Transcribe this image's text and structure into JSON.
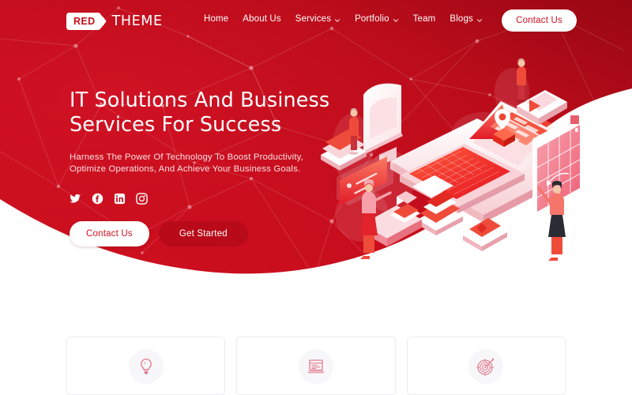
{
  "site": {
    "brand": {
      "mark_text": "RED",
      "name_text": "THEME",
      "logo_icon": "tag-bubble-logo-icon"
    }
  },
  "colors": {
    "brand_red": "#c70d1d",
    "brand_red_dark": "#a50817",
    "brand_red_deep": "#b80a19",
    "hero_text": "#ffffff",
    "hero_subtext": "#fbdfe2",
    "card_icon": "#e0798c",
    "card_circle_bg": "#f7f7f9",
    "page_bg": "#ffffff"
  },
  "nav": {
    "items": [
      {
        "label": "Home",
        "has_dropdown": false,
        "icon": ""
      },
      {
        "label": "About Us",
        "has_dropdown": false,
        "icon": ""
      },
      {
        "label": "Services",
        "has_dropdown": true,
        "icon": "chevron-down-icon"
      },
      {
        "label": "Portfolio",
        "has_dropdown": true,
        "icon": "chevron-down-icon"
      },
      {
        "label": "Team",
        "has_dropdown": false,
        "icon": ""
      },
      {
        "label": "Blogs",
        "has_dropdown": true,
        "icon": "chevron-down-icon"
      }
    ],
    "cta_label": "Contact Us"
  },
  "hero": {
    "title_line_1": "IT Solutions And Business",
    "title_line_2": "Services For Success",
    "subtitle": "Harness The Power Of Technology To Boost Productivity, Optimize Operations, And Achieve Your Business Goals.",
    "socials": [
      {
        "name": "twitter-icon",
        "label": "Twitter"
      },
      {
        "name": "facebook-icon",
        "label": "Facebook"
      },
      {
        "name": "linkedin-icon",
        "label": "LinkedIn"
      },
      {
        "name": "instagram-icon",
        "label": "Instagram"
      }
    ],
    "primary_button": "Contact Us",
    "secondary_button": "Get Started",
    "illustration": "isometric-it-workspace-illustration"
  },
  "feature_cards": [
    {
      "icon": "lightbulb-icon",
      "label": ""
    },
    {
      "icon": "laptop-browser-icon",
      "label": ""
    },
    {
      "icon": "target-dart-icon",
      "label": ""
    }
  ]
}
